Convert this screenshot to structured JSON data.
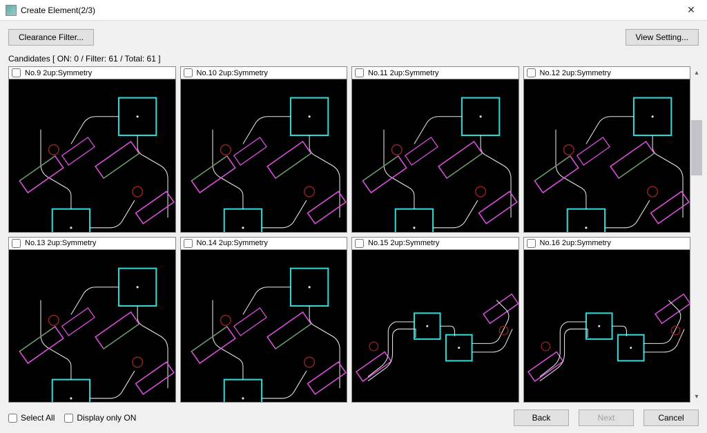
{
  "window": {
    "title": "Create Element(2/3)"
  },
  "toolbar": {
    "clearance_filter": "Clearance Filter...",
    "view_setting": "View Setting..."
  },
  "candidates": {
    "label_template": "Candidates [ ON: {on} / Filter: {filter} / Total: {total} ]",
    "label": "Candidates [ ON: 0 / Filter: 61 / Total: 61 ]",
    "on": 0,
    "filter": 61,
    "total": 61
  },
  "tiles": [
    {
      "no": 9,
      "label": "No.9  2up:Symmetry",
      "checked": false,
      "variant": "A"
    },
    {
      "no": 10,
      "label": "No.10  2up:Symmetry",
      "checked": false,
      "variant": "A"
    },
    {
      "no": 11,
      "label": "No.11  2up:Symmetry",
      "checked": false,
      "variant": "A"
    },
    {
      "no": 12,
      "label": "No.12  2up:Symmetry",
      "checked": false,
      "variant": "A"
    },
    {
      "no": 13,
      "label": "No.13  2up:Symmetry",
      "checked": false,
      "variant": "A"
    },
    {
      "no": 14,
      "label": "No.14  2up:Symmetry",
      "checked": false,
      "variant": "A"
    },
    {
      "no": 15,
      "label": "No.15  2up:Symmetry",
      "checked": false,
      "variant": "B"
    },
    {
      "no": 16,
      "label": "No.16  2up:Symmetry",
      "checked": false,
      "variant": "B"
    }
  ],
  "footer": {
    "select_all": "Select All",
    "display_only_on": "Display only ON",
    "back": "Back",
    "next": "Next",
    "cancel": "Cancel",
    "select_all_checked": false,
    "display_only_on_checked": false,
    "next_enabled": false
  },
  "colors": {
    "cyan": "#2fd6d6",
    "magenta": "#e050e0",
    "darkred": "#8b2020",
    "white": "#e8e8e8",
    "green": "#30c030"
  }
}
